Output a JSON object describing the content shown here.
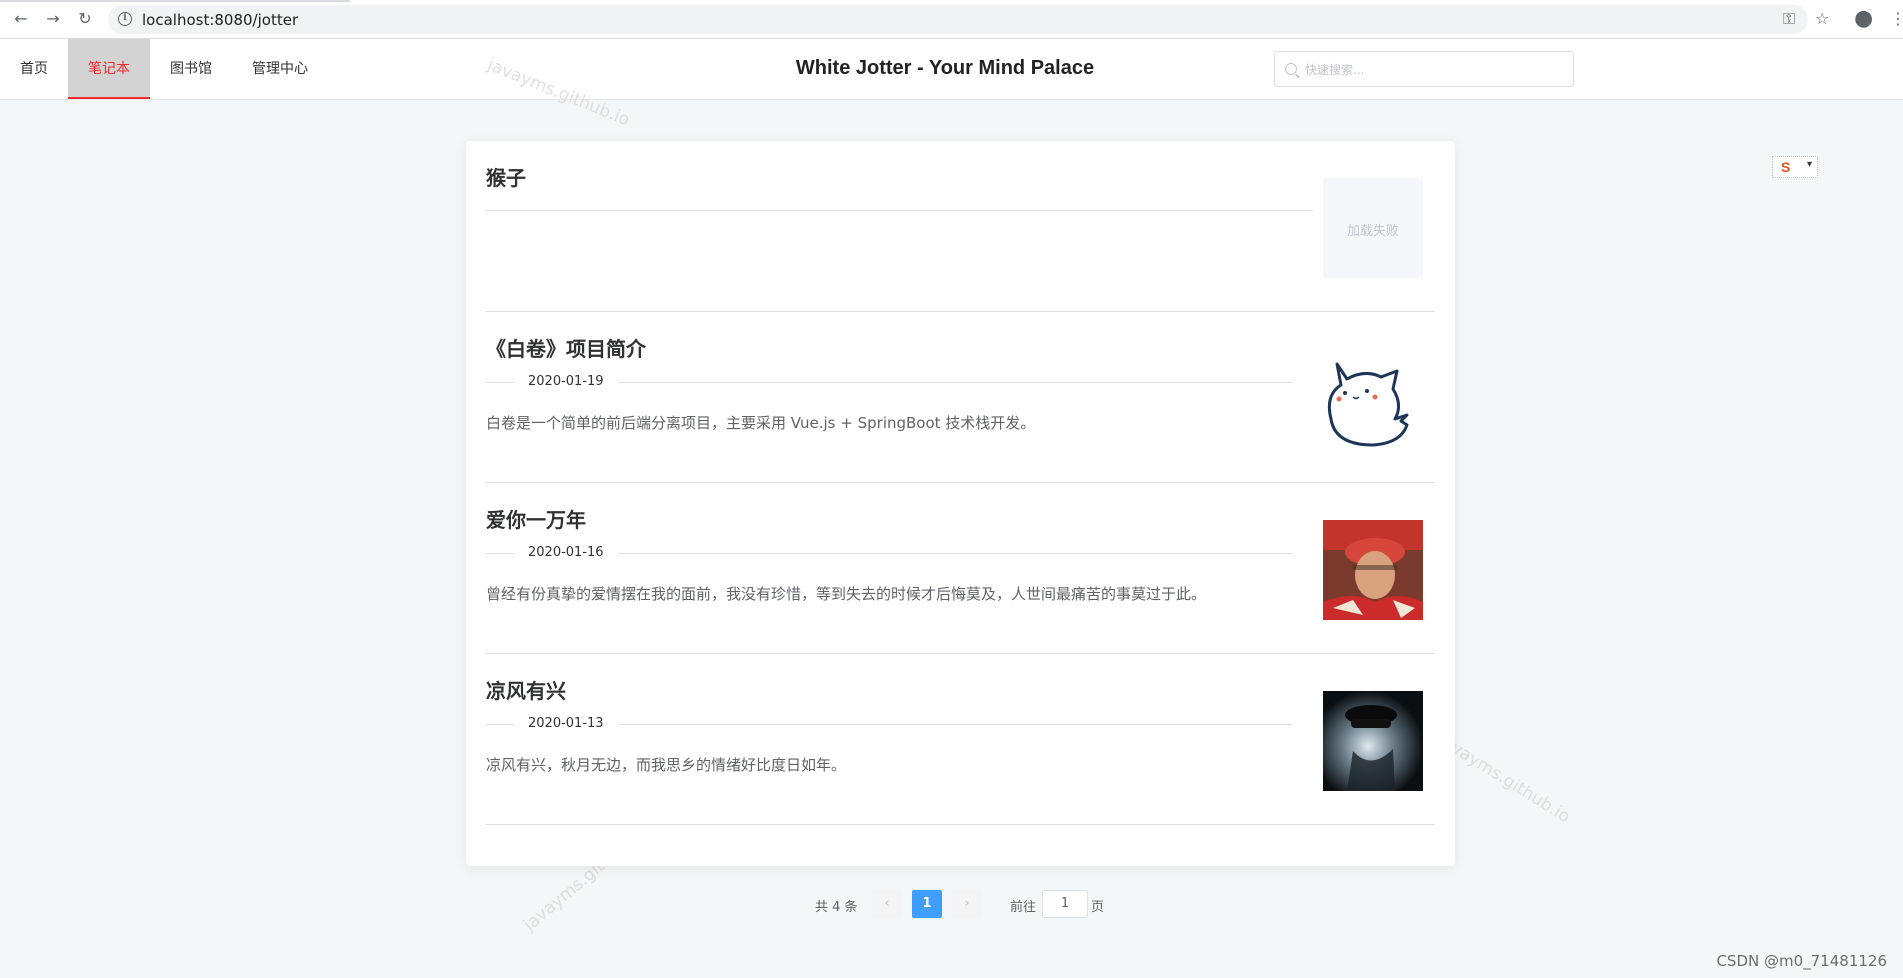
{
  "browser": {
    "url": "localhost:8080/jotter",
    "back_icon": "arrow-left-icon",
    "forward_icon": "arrow-right-icon",
    "reload_icon": "reload-icon"
  },
  "nav": {
    "items": [
      {
        "label": "首页",
        "active": false
      },
      {
        "label": "笔记本",
        "active": true
      },
      {
        "label": "图书馆",
        "active": false
      },
      {
        "label": "管理中心",
        "active": false
      }
    ],
    "site_title": "White Jotter - Your Mind Palace",
    "search_placeholder": "快速搜索..."
  },
  "articles": [
    {
      "title": "猴子",
      "date": "",
      "abstract": "",
      "cover": "failed",
      "cover_text": "加载失败"
    },
    {
      "title": "《白卷》项目简介",
      "date": "2020-01-19",
      "abstract": "白卷是一个简单的前后端分离项目，主要采用 Vue.js + SpringBoot 技术栈开发。",
      "cover": "cat-illustration"
    },
    {
      "title": "爱你一万年",
      "date": "2020-01-16",
      "abstract": "曾经有份真挚的爱情摆在我的面前，我没有珍惜，等到失去的时候才后悔莫及，人世间最痛苦的事莫过于此。",
      "cover": "photo-red-costume"
    },
    {
      "title": "凉风有兴",
      "date": "2020-01-13",
      "abstract": "凉风有兴，秋月无边，而我思乡的情绪好比度日如年。",
      "cover": "photo-dark-sunglasses"
    }
  ],
  "watermark": "javayms.github.io",
  "pagination": {
    "total_label": "共 4 条",
    "current_page": "1",
    "goto_label": "前往",
    "goto_value": "1",
    "page_suffix": "页"
  },
  "footer_credit": "CSDN @m0_71481126",
  "colors": {
    "accent": "#409eff",
    "nav_active": "#f02a2a"
  }
}
